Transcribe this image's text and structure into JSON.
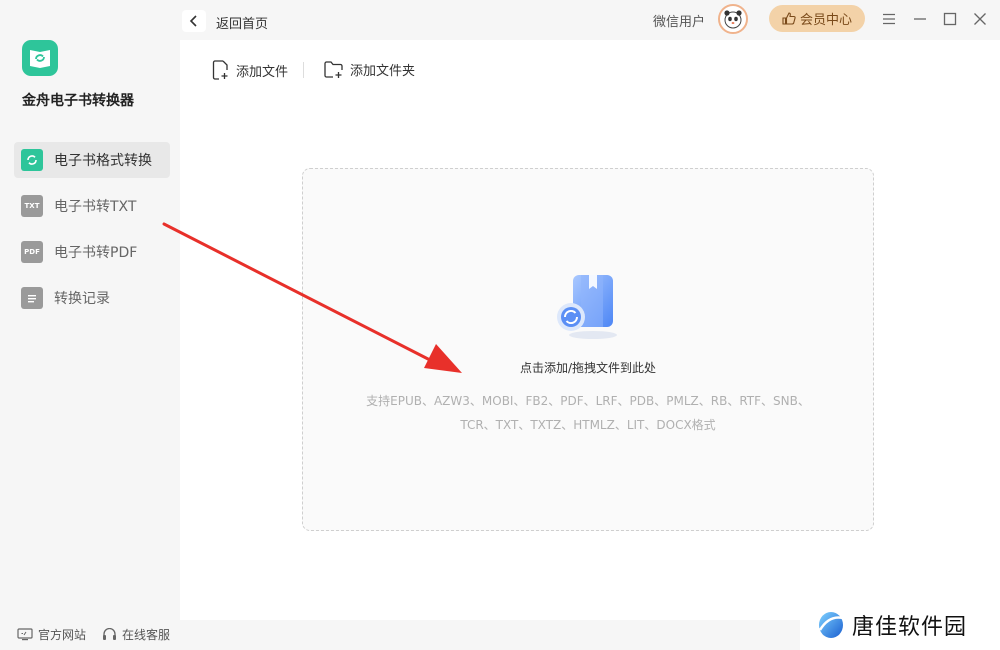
{
  "app": {
    "name": "金舟电子书转换器"
  },
  "sidebar": {
    "items": [
      {
        "label": "电子书格式转换",
        "icon": "refresh-book-icon",
        "active": true
      },
      {
        "label": "电子书转TXT",
        "icon": "txt-file-icon",
        "icon_text": "TXT"
      },
      {
        "label": "电子书转PDF",
        "icon": "pdf-file-icon",
        "icon_text": "PDF"
      },
      {
        "label": "转换记录",
        "icon": "record-list-icon"
      }
    ],
    "footer": {
      "website_label": "官方网站",
      "support_label": "在线客服"
    }
  },
  "header": {
    "back_label": "返回首页",
    "user_name": "微信用户",
    "vip_label": "会员中心"
  },
  "toolbar": {
    "add_file_label": "添加文件",
    "add_folder_label": "添加文件夹"
  },
  "dropzone": {
    "title": "点击添加/拖拽文件到此处",
    "formats_line1": "支持EPUB、AZW3、MOBI、FB2、PDF、LRF、PDB、PMLZ、RB、RTF、SNB、",
    "formats_line2": "TCR、TXT、TXTZ、HTMLZ、LIT、DOCX格式"
  },
  "watermark": {
    "text": "唐佳软件园"
  },
  "colors": {
    "accent": "#2ec59a",
    "vip_bg": "#f3d2a8",
    "annotation_arrow": "#e8302a"
  }
}
